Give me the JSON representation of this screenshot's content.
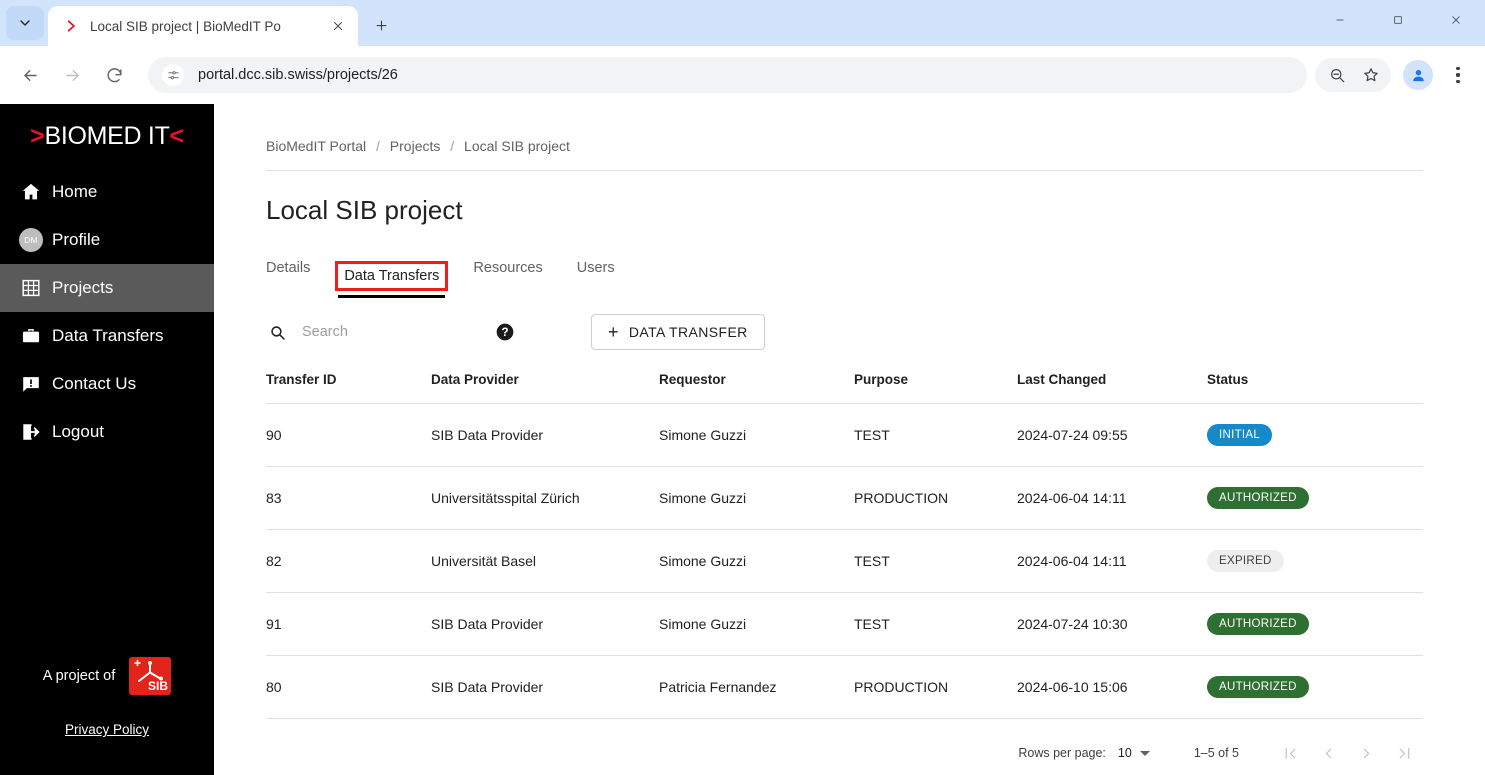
{
  "browser": {
    "tab": {
      "title": "Local SIB project | BioMedIT Po",
      "favicon": "biomedit-chevron-icon"
    },
    "url": "portal.dcc.sib.swiss/projects/26",
    "controls": {
      "minimize": "minimize",
      "maximize": "maximize",
      "close": "close"
    }
  },
  "sidebar": {
    "logo": {
      "left_chevron": ">",
      "text": "BIOMED IT",
      "right_chevron": "<"
    },
    "items": [
      {
        "label": "Home",
        "icon": "home-icon",
        "active": false
      },
      {
        "label": "Profile",
        "icon": "avatar-initials-icon",
        "initials": "DM",
        "active": false
      },
      {
        "label": "Projects",
        "icon": "grid-icon",
        "active": true
      },
      {
        "label": "Data Transfers",
        "icon": "briefcase-icon",
        "active": false
      },
      {
        "label": "Contact Us",
        "icon": "chat-alert-icon",
        "active": false
      },
      {
        "label": "Logout",
        "icon": "logout-icon",
        "active": false
      }
    ],
    "footer": {
      "project_of": "A project of",
      "sib_logo_alt": "SIB",
      "privacy": "Privacy Policy"
    }
  },
  "breadcrumb": {
    "items": [
      "BioMedIT Portal",
      "Projects",
      "Local SIB project"
    ],
    "separator": "/"
  },
  "page": {
    "title": "Local SIB project"
  },
  "tabs": [
    {
      "label": "Details",
      "selected": false,
      "highlighted": false
    },
    {
      "label": "Data Transfers",
      "selected": true,
      "highlighted": true
    },
    {
      "label": "Resources",
      "selected": false,
      "highlighted": false
    },
    {
      "label": "Users",
      "selected": false,
      "highlighted": false
    }
  ],
  "toolbar": {
    "search_placeholder": "Search",
    "search_value": "",
    "help_icon": "help-circle-icon",
    "new_button": "DATA TRANSFER",
    "new_button_plus": "+"
  },
  "table": {
    "columns": [
      "Transfer ID",
      "Data Provider",
      "Requestor",
      "Purpose",
      "Last Changed",
      "Status"
    ],
    "rows": [
      {
        "id": "90",
        "provider": "SIB Data Provider",
        "requestor": "Simone Guzzi",
        "purpose": "TEST",
        "changed": "2024-07-24 09:55",
        "status": "INITIAL",
        "status_class": "initial"
      },
      {
        "id": "83",
        "provider": "Universitätsspital Zürich",
        "requestor": "Simone Guzzi",
        "purpose": "PRODUCTION",
        "changed": "2024-06-04 14:11",
        "status": "AUTHORIZED",
        "status_class": "authorized"
      },
      {
        "id": "82",
        "provider": "Universität Basel",
        "requestor": "Simone Guzzi",
        "purpose": "TEST",
        "changed": "2024-06-04 14:11",
        "status": "EXPIRED",
        "status_class": "expired"
      },
      {
        "id": "91",
        "provider": "SIB Data Provider",
        "requestor": "Simone Guzzi",
        "purpose": "TEST",
        "changed": "2024-07-24 10:30",
        "status": "AUTHORIZED",
        "status_class": "authorized"
      },
      {
        "id": "80",
        "provider": "SIB Data Provider",
        "requestor": "Patricia Fernandez",
        "purpose": "PRODUCTION",
        "changed": "2024-06-10 15:06",
        "status": "AUTHORIZED",
        "status_class": "authorized"
      }
    ]
  },
  "pagination": {
    "rows_per_page_label": "Rows per page:",
    "rows_per_page_value": "10",
    "range": "1–5 of 5",
    "first": "first-page-icon",
    "prev": "previous-page-icon",
    "next": "next-page-icon",
    "last": "last-page-icon"
  },
  "colors": {
    "brand_red": "#e8112d",
    "sidebar_bg": "#000000",
    "status_initial": "#1689ca",
    "status_authorized": "#2e7031",
    "status_expired": "#eeeeee",
    "highlight_outline": "#f01d1d"
  }
}
